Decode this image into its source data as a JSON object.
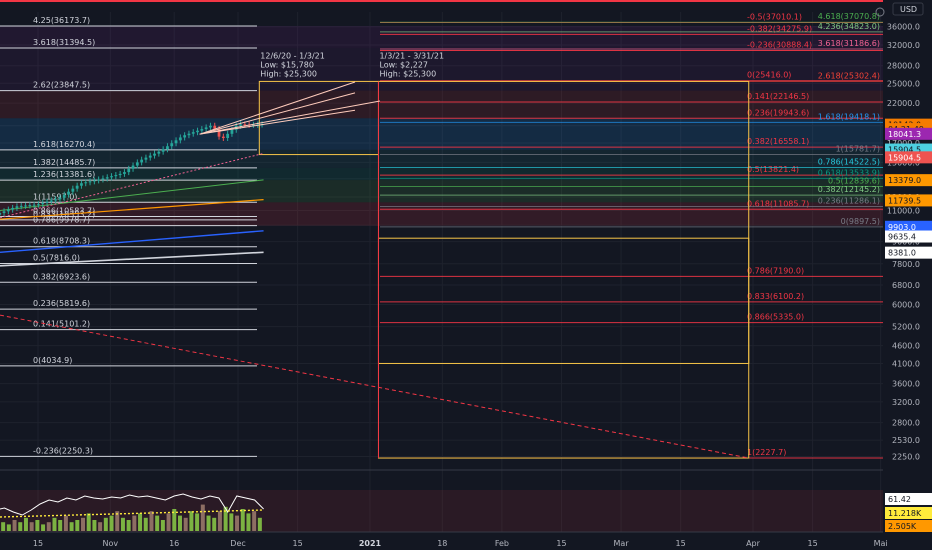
{
  "chart_data": {
    "type": "line",
    "scale": "log",
    "currency_label": "USD",
    "y_ticks": [
      2250,
      2500,
      2800,
      3200,
      3600,
      4100,
      4600,
      5200,
      6000,
      6800,
      7800,
      9000,
      10000,
      11000,
      12000,
      13500,
      15000,
      17000,
      19000,
      22000,
      25000,
      28000,
      32000,
      36000
    ],
    "y_tick_labels": [
      "2250.0",
      "2530.0",
      "2800.0",
      "3200.0",
      "3600.0",
      "4100.0",
      "4600.0",
      "5200.0",
      "6000.0",
      "6800.0",
      "7800.0",
      "9000.0",
      "10000.0",
      "11000.0",
      "12000.0",
      "13500.0",
      "15000.0",
      "17000.0",
      "19000.0",
      "22000.0",
      "25000.0",
      "28000.0",
      "32000.0",
      "36000.0"
    ],
    "x_ticks": [
      {
        "label": "15",
        "date": "2020-10-15"
      },
      {
        "label": "Nov",
        "date": "2020-11-01"
      },
      {
        "label": "16",
        "date": "2020-11-16"
      },
      {
        "label": "Dec",
        "date": "2020-12-01"
      },
      {
        "label": "15",
        "date": "2020-12-15"
      },
      {
        "label": "2021",
        "date": "2021-01-01"
      },
      {
        "label": "18",
        "date": "2021-01-18"
      },
      {
        "label": "Feb",
        "date": "2021-02-01"
      },
      {
        "label": "15",
        "date": "2021-02-15"
      },
      {
        "label": "Mar",
        "date": "2021-03-01"
      },
      {
        "label": "15",
        "date": "2021-03-15"
      },
      {
        "label": "Apr",
        "date": "2021-04-01"
      },
      {
        "label": "15",
        "date": "2021-04-15"
      },
      {
        "label": "Mai",
        "date": "2021-05-01"
      }
    ],
    "left_fib_levels": [
      {
        "label": "4.25(36173.7)",
        "value": 36173.7,
        "color": "#d1d4dc"
      },
      {
        "label": "3.618(31394.5)",
        "value": 31394.5,
        "color": "#d1d4dc"
      },
      {
        "label": "2.62(23847.5)",
        "value": 23847.5,
        "color": "#d1d4dc"
      },
      {
        "label": "1.618(16270.4)",
        "value": 16270.4,
        "color": "#d1d4dc"
      },
      {
        "label": "1.382(14485.7)",
        "value": 14485.7,
        "color": "#d1d4dc"
      },
      {
        "label": "1.236(13381.6)",
        "value": 13381.6,
        "color": "#d1d4dc"
      },
      {
        "label": "1(11597.0)",
        "value": 11597.0,
        "color": "#d1d4dc"
      },
      {
        "label": "0.866(10583.7)",
        "value": 10583.7,
        "color": "#d1d4dc"
      },
      {
        "label": "0.833(10353.2)",
        "value": 10353.2,
        "color": "#d1d4dc"
      },
      {
        "label": "0.786(9978.7)",
        "value": 9978.7,
        "color": "#d1d4dc"
      },
      {
        "label": "0.618(8708.3)",
        "value": 8708.3,
        "color": "#d1d4dc"
      },
      {
        "label": "0.5(7816.0)",
        "value": 7816.0,
        "color": "#d1d4dc"
      },
      {
        "label": "0.382(6923.6)",
        "value": 6923.6,
        "color": "#d1d4dc"
      },
      {
        "label": "0.236(5819.6)",
        "value": 5819.6,
        "color": "#d1d4dc"
      },
      {
        "label": "0.141(5101.2)",
        "value": 5101.2,
        "color": "#d1d4dc"
      },
      {
        "label": "0(4034.9)",
        "value": 4034.9,
        "color": "#d1d4dc"
      },
      {
        "label": "-0.236(2250.3)",
        "value": 2250.3,
        "color": "#d1d4dc"
      }
    ],
    "right_fib_levels_red": [
      {
        "label": "-0.5(37010.1)",
        "value": 37010.1
      },
      {
        "label": "-0.382(34275.9)",
        "value": 34275.9
      },
      {
        "label": "-0.236(30888.4)",
        "value": 30888.4
      },
      {
        "label": "0(25416.0)",
        "value": 25416.0
      },
      {
        "label": "0.141(22146.5)",
        "value": 22146.5
      },
      {
        "label": "0.236(19943.6)",
        "value": 19943.6
      },
      {
        "label": "0.382(16558.1)",
        "value": 16558.1
      },
      {
        "label": "0.5(13821.4)",
        "value": 13821.4
      },
      {
        "label": "0.618(11085.7)",
        "value": 11085.7
      },
      {
        "label": "0.786(7190.0)",
        "value": 7190.0
      },
      {
        "label": "0.833(6100.2)",
        "value": 6100.2
      },
      {
        "label": "0.866(5335.0)",
        "value": 5335.0
      },
      {
        "label": "1(2227.7)",
        "value": 2227.7
      }
    ],
    "right_fib_levels_other": [
      {
        "label": "4.618(37070.8)",
        "value": 37070.8,
        "color": "#4caf50"
      },
      {
        "label": "4.236(34823.0)",
        "value": 34823.0,
        "color": "#81c784"
      },
      {
        "label": "3.618(31186.6)",
        "value": 31186.6,
        "color": "#f06292"
      },
      {
        "label": "2.618(25302.4)",
        "value": 25302.4,
        "color": "#f44336"
      },
      {
        "label": "1.618(19418.1)",
        "value": 19418.1,
        "color": "#2196f3"
      },
      {
        "label": "1(15781.7)",
        "value": 15781.7,
        "color": "#787b86"
      },
      {
        "label": "0.786(14522.5)",
        "value": 14522.5,
        "color": "#26c6da"
      },
      {
        "label": "0.618(13533.9)",
        "value": 13533.9,
        "color": "#089981"
      },
      {
        "label": "0.5(12839.6)",
        "value": 12839.6,
        "color": "#4caf50"
      },
      {
        "label": "0.382(12145.2)",
        "value": 12145.2,
        "color": "#81c784"
      },
      {
        "label": "0.236(11286.1)",
        "value": 11286.1,
        "color": "#787b86"
      },
      {
        "label": "0(9897.5)",
        "value": 9897.5,
        "color": "#787b86"
      }
    ],
    "range_boxes": [
      {
        "dates": "12/6/20 - 1/3/21",
        "low": "Low: $15,780",
        "high": "High: $25,300",
        "x_start": "2020-12-06",
        "x_end": "2021-01-03",
        "low_value": 15780,
        "high_value": 25300,
        "color": "#f7c548"
      },
      {
        "dates": "1/3/21 - 3/31/21",
        "low": "Low: $2,227",
        "high": "High: $25,300",
        "x_start": "2021-01-03",
        "x_end": "2021-03-31",
        "low_value": 2227,
        "high_value": 25300,
        "color": "#f7c548"
      }
    ],
    "right_badges": [
      {
        "text": "19142.0",
        "value": 19142.0,
        "bg": "#f57c00",
        "fg": "#131722"
      },
      {
        "text": "04:21:49",
        "value": 18600.0,
        "bg": "#f57c00",
        "fg": "#131722"
      },
      {
        "text": "18041.3",
        "value": 18041.3,
        "bg": "#9c27b0",
        "fg": "#ffffff"
      },
      {
        "text": "15904.5",
        "value": 16300.0,
        "bg": "#4dd0e1",
        "fg": "#131722"
      },
      {
        "text": "15904.5",
        "value": 15500.0,
        "bg": "#ef5350",
        "fg": "#ffffff"
      },
      {
        "text": "13379.0",
        "value": 13379.0,
        "bg": "#ff9800",
        "fg": "#131722"
      },
      {
        "text": "11739.5",
        "value": 11739.5,
        "bg": "#ff9800",
        "fg": "#131722"
      },
      {
        "text": "9903.0",
        "value": 9903.0,
        "bg": "#2962ff",
        "fg": "#ffffff"
      },
      {
        "text": "9635.4",
        "value": 9300.0,
        "bg": "#ffffff",
        "fg": "#131722"
      },
      {
        "text": "8381.0",
        "value": 8381.0,
        "bg": "#ffffff",
        "fg": "#131722"
      }
    ],
    "indicator": {
      "badges": [
        {
          "text": "61.42",
          "bg": "#ffffff",
          "fg": "#131722"
        },
        {
          "text": "11.218K",
          "bg": "#ffeb3b",
          "fg": "#131722"
        },
        {
          "text": "2.505K",
          "bg": "#ff9800",
          "fg": "#131722"
        }
      ]
    },
    "price_path": [
      {
        "date": "2020-10-05",
        "value": 10700
      },
      {
        "date": "2020-10-10",
        "value": 11300
      },
      {
        "date": "2020-10-15",
        "value": 11450
      },
      {
        "date": "2020-10-20",
        "value": 11900
      },
      {
        "date": "2020-10-25",
        "value": 13100
      },
      {
        "date": "2020-10-30",
        "value": 13500
      },
      {
        "date": "2020-11-04",
        "value": 14000
      },
      {
        "date": "2020-11-08",
        "value": 15200
      },
      {
        "date": "2020-11-13",
        "value": 16200
      },
      {
        "date": "2020-11-18",
        "value": 17800
      },
      {
        "date": "2020-11-22",
        "value": 18500
      },
      {
        "date": "2020-11-25",
        "value": 19100
      },
      {
        "date": "2020-11-27",
        "value": 17300
      },
      {
        "date": "2020-12-01",
        "value": 19200
      },
      {
        "date": "2020-12-04",
        "value": 19100
      },
      {
        "date": "2020-12-07",
        "value": 19200
      }
    ],
    "volume": [
      3,
      4,
      3,
      5,
      4,
      6,
      4,
      5,
      3,
      4,
      6,
      5,
      7,
      4,
      5,
      6,
      8,
      5,
      4,
      6,
      7,
      9,
      6,
      5,
      7,
      8,
      6,
      9,
      7,
      5,
      8,
      10,
      7,
      6,
      9,
      8,
      12,
      7,
      6,
      9,
      11,
      8,
      7,
      10,
      8,
      9,
      6
    ],
    "indicator_line": [
      60,
      62,
      58,
      55,
      60,
      66,
      70,
      68,
      72,
      70,
      74,
      72,
      71,
      73,
      72,
      75,
      73,
      74,
      72,
      70,
      74,
      76,
      73,
      71,
      74,
      72,
      58,
      74,
      72,
      70,
      61
    ]
  }
}
